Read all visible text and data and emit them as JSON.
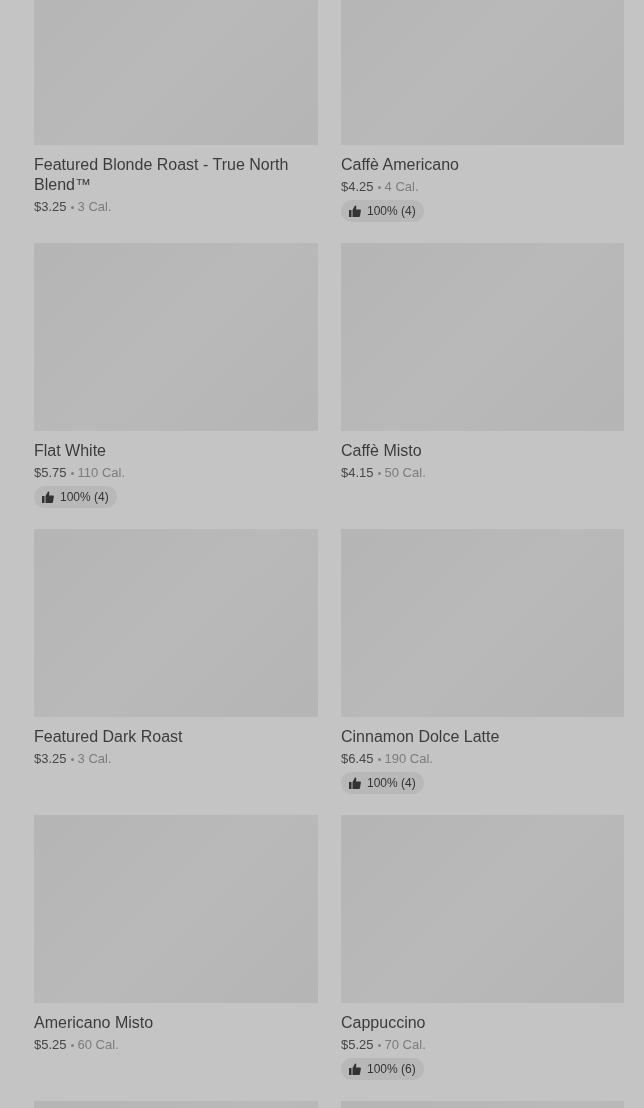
{
  "items": [
    {
      "kind": "item",
      "name": "Featured Blonde Roast - True North Blend™",
      "price": "$3.25",
      "calories": "3 Cal."
    },
    {
      "kind": "item",
      "name": "Caffè Americano",
      "price": "$4.25",
      "calories": "4 Cal.",
      "rating": "100% (4)"
    },
    {
      "kind": "item",
      "name": "Flat White",
      "price": "$5.75",
      "calories": "110 Cal.",
      "rating": "100% (4)"
    },
    {
      "kind": "item",
      "name": "Caffè Misto",
      "price": "$4.15",
      "calories": "50 Cal."
    },
    {
      "kind": "item",
      "name": "Featured Dark Roast",
      "price": "$3.25",
      "calories": "3 Cal."
    },
    {
      "kind": "item",
      "name": "Cinnamon Dolce Latte",
      "price": "$6.45",
      "calories": "190 Cal.",
      "rating": "100% (4)"
    },
    {
      "kind": "item",
      "name": "Americano Misto",
      "price": "$5.25",
      "calories": "60 Cal."
    },
    {
      "kind": "item",
      "name": "Cappuccino",
      "price": "$5.25",
      "calories": "70 Cal.",
      "rating": "100% (6)"
    },
    {
      "kind": "cut"
    },
    {
      "kind": "cut"
    }
  ]
}
